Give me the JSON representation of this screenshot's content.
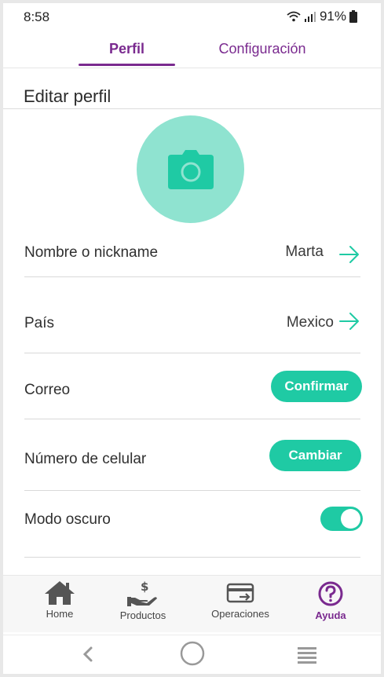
{
  "status": {
    "time": "8:58",
    "battery": "91%"
  },
  "tabs": [
    {
      "label": "Perfil",
      "active": true
    },
    {
      "label": "Configuración",
      "active": false
    }
  ],
  "page": {
    "title": "Editar perfil"
  },
  "profile": {
    "avatar_icon": "camera-icon",
    "rows": {
      "nickname": {
        "label": "Nombre o nickname",
        "value": "Marta"
      },
      "country": {
        "label": "País",
        "value": "Mexico"
      },
      "email": {
        "label": "Correo",
        "action": "Confirmar"
      },
      "phone": {
        "label": "Número de celular",
        "action": "Cambiar"
      },
      "dark_mode": {
        "label": "Modo oscuro",
        "enabled": true
      }
    }
  },
  "bottom_nav": [
    {
      "label": "Home",
      "icon": "home-icon",
      "active": false
    },
    {
      "label": "Productos",
      "icon": "hand-dollar-icon",
      "active": false
    },
    {
      "label": "Operaciones",
      "icon": "card-transfer-icon",
      "active": false
    },
    {
      "label": "Ayuda",
      "icon": "help-circle-icon",
      "active": true
    }
  ],
  "colors": {
    "accent": "#1fcaa4",
    "brand": "#7a2a8f",
    "avatar_bg": "#8fe3d0"
  }
}
